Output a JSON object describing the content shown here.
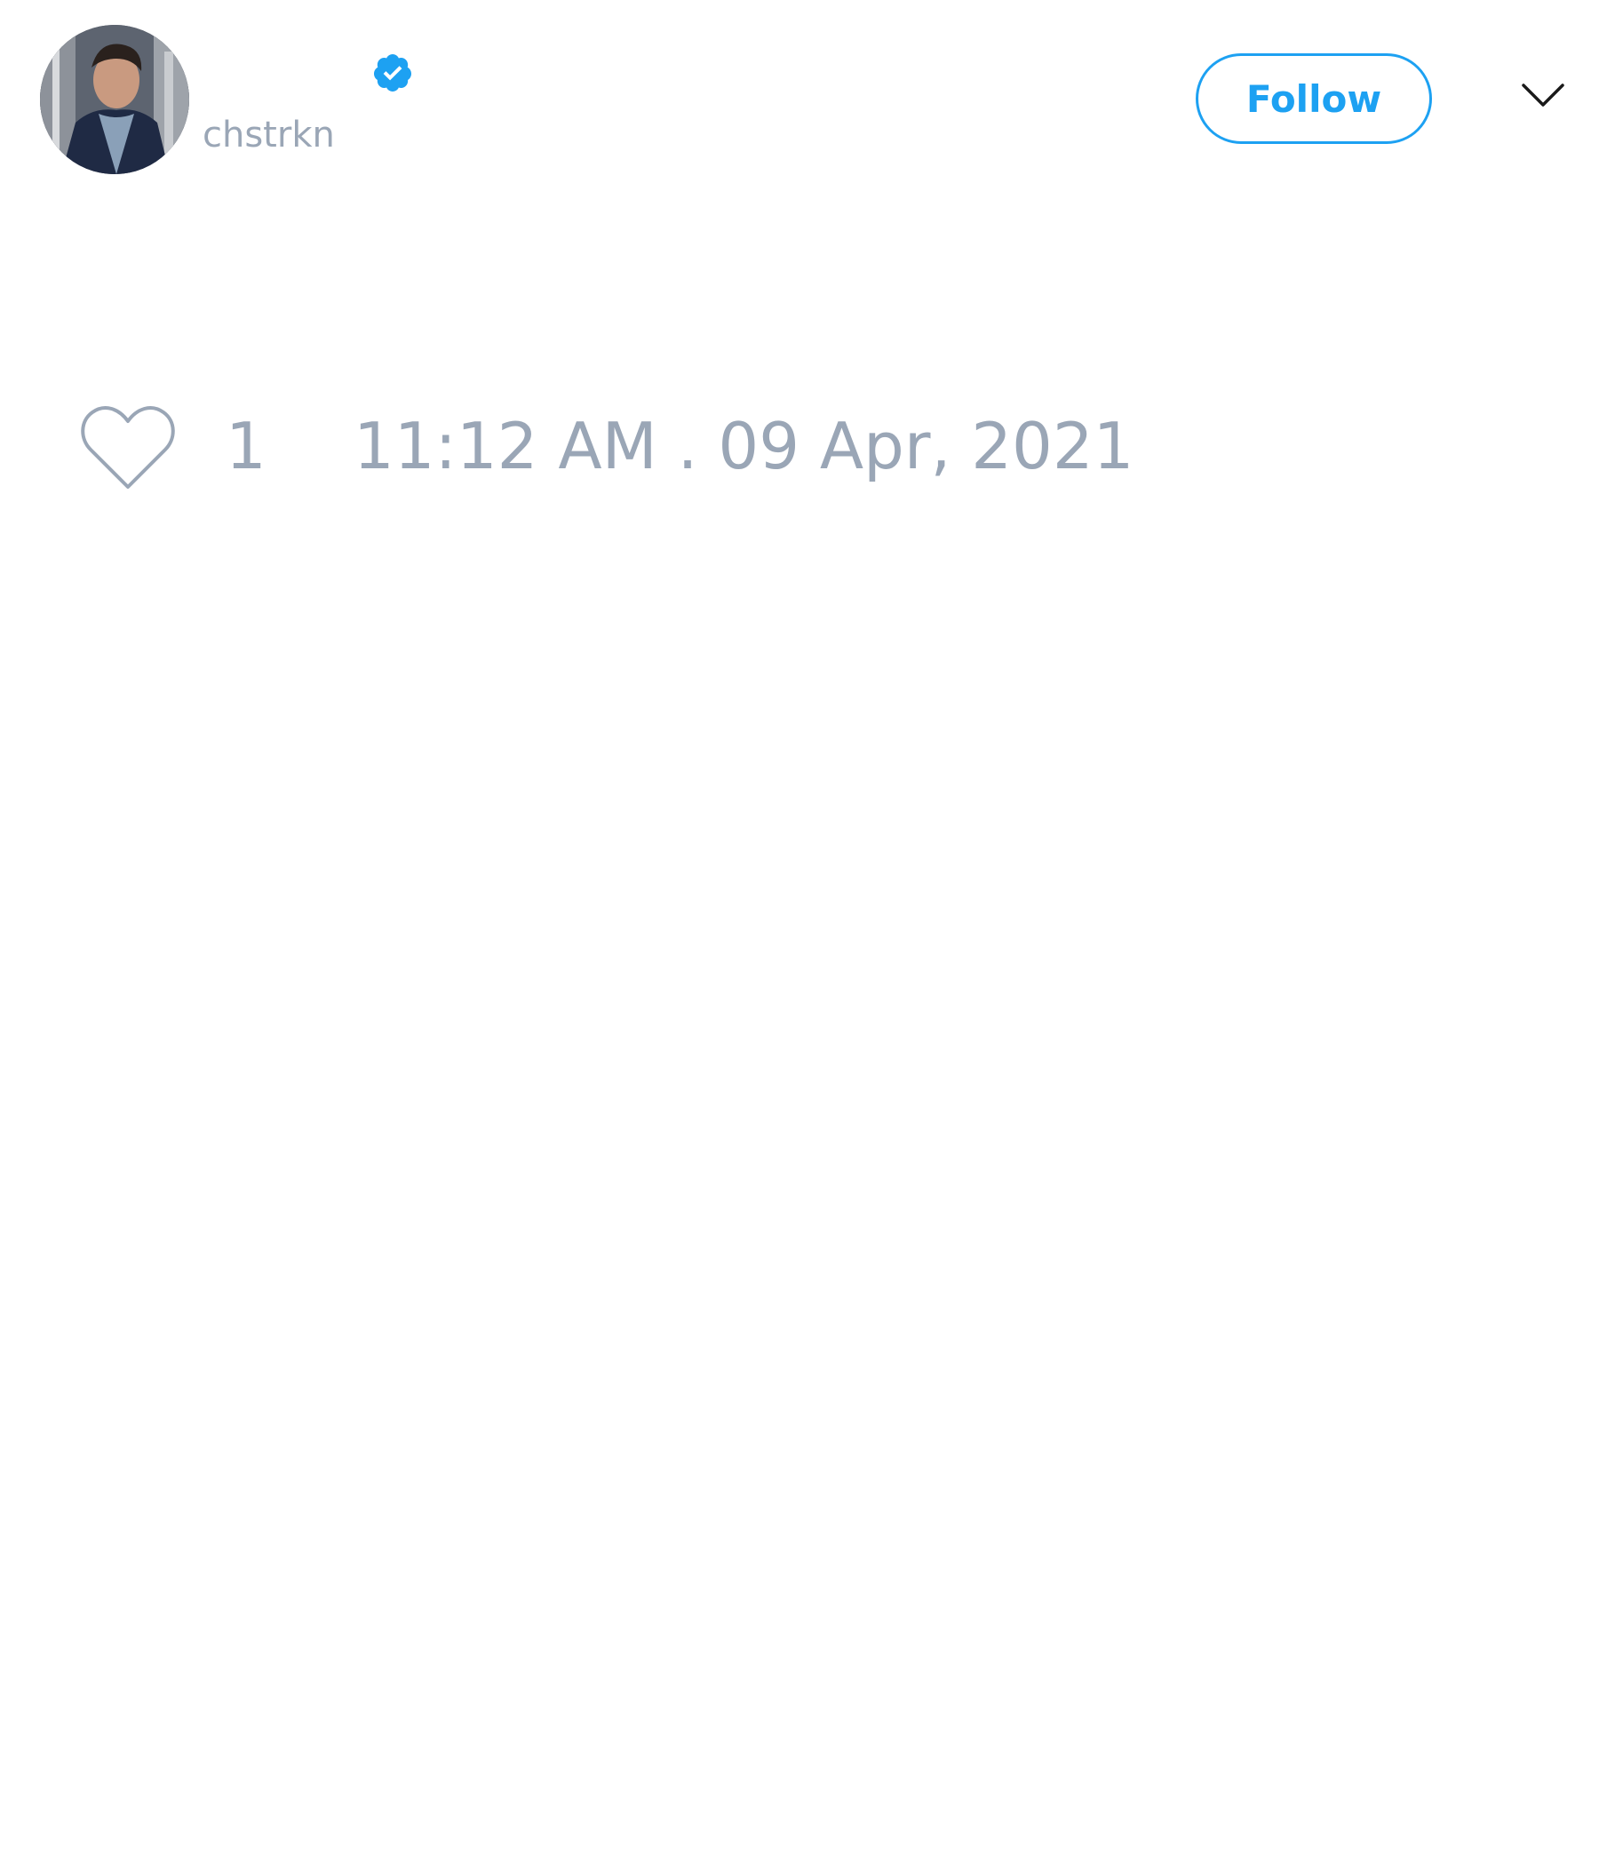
{
  "author": {
    "handle": "chstrkn",
    "verified": true,
    "avatar_icon": "avatar-photo"
  },
  "header": {
    "follow_label": "Follow",
    "menu_icon": "chevron-down-icon"
  },
  "engagement": {
    "like_icon": "heart-icon",
    "like_count": "1",
    "timestamp": "11:12 AM . 09 Apr, 2021"
  },
  "colors": {
    "accent": "#1da1f2",
    "muted_text": "#9aa6b6",
    "background": "#ffffff"
  }
}
